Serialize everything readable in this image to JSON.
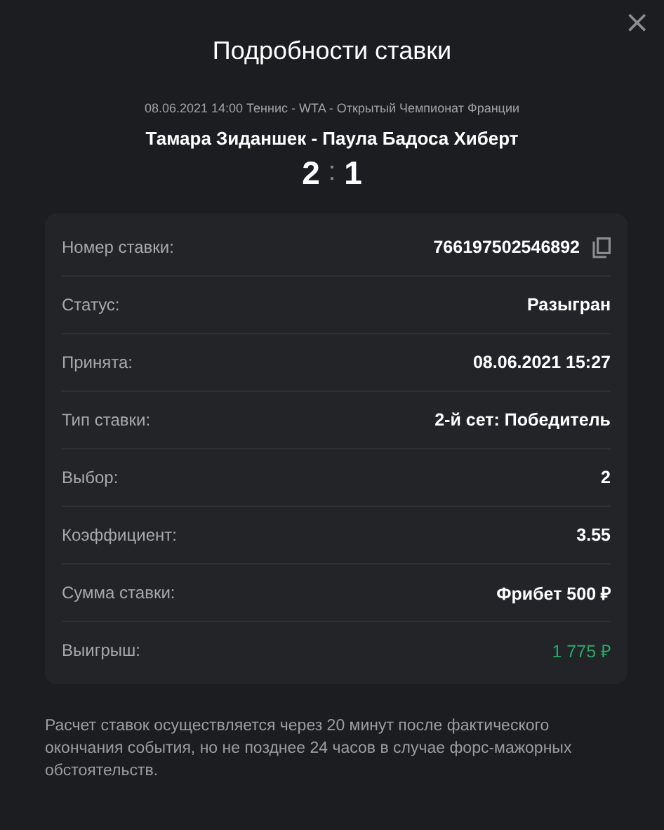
{
  "dialog": {
    "title": "Подробности ставки",
    "close": "×"
  },
  "event": {
    "meta": "08.06.2021 14:00 Теннис - WTA - Открытый Чемпионат Франции",
    "match": "Тамара Зиданшек - Паула Бадоса Хиберт",
    "score_home": "2",
    "separator": ":",
    "score_away": "1"
  },
  "details": [
    {
      "kind": "copy",
      "label": "Номер ставки:",
      "value": "766197502546892"
    },
    {
      "kind": "plain",
      "label": "Статус:",
      "value": "Разыгран"
    },
    {
      "kind": "plain",
      "label": "Принята:",
      "value": "08.06.2021 15:27"
    },
    {
      "kind": "plain",
      "label": "Тип ставки:",
      "value": "2-й сет: Победитель"
    },
    {
      "kind": "plain",
      "label": "Выбор:",
      "value": "2"
    },
    {
      "kind": "plain",
      "label": "Коэффициент:",
      "value": "3.55"
    },
    {
      "kind": "plain",
      "label": "Сумма ставки:",
      "value": "Фрибет 500 ₽"
    },
    {
      "kind": "win",
      "label": "Выигрыш:",
      "value": "1 775 ₽"
    }
  ],
  "note": "Расчет ставок осуществляется через 20 минут после фактического окончания события, но не позднее 24 часов в случае форс-мажорных обстоятельств."
}
